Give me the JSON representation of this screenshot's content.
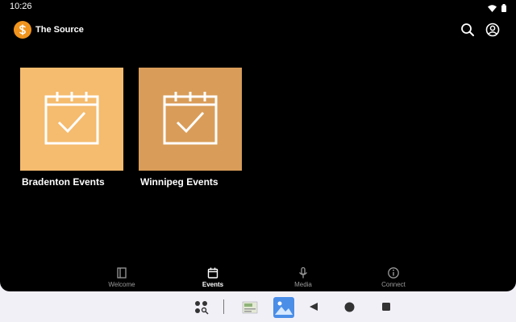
{
  "status": {
    "time": "10:26"
  },
  "app": {
    "title": "The Source"
  },
  "events": [
    {
      "label": "Bradenton Events",
      "color": "#f5bb6e"
    },
    {
      "label": "Winnipeg Events",
      "color": "#d99d59"
    }
  ],
  "nav": [
    {
      "label": "Welcome",
      "icon": "book-icon"
    },
    {
      "label": "Events",
      "icon": "calendar-icon"
    },
    {
      "label": "Media",
      "icon": "microphone-icon"
    },
    {
      "label": "Connect",
      "icon": "info-icon"
    }
  ],
  "colors": {
    "accent": "#f0941d",
    "background": "#000000"
  }
}
